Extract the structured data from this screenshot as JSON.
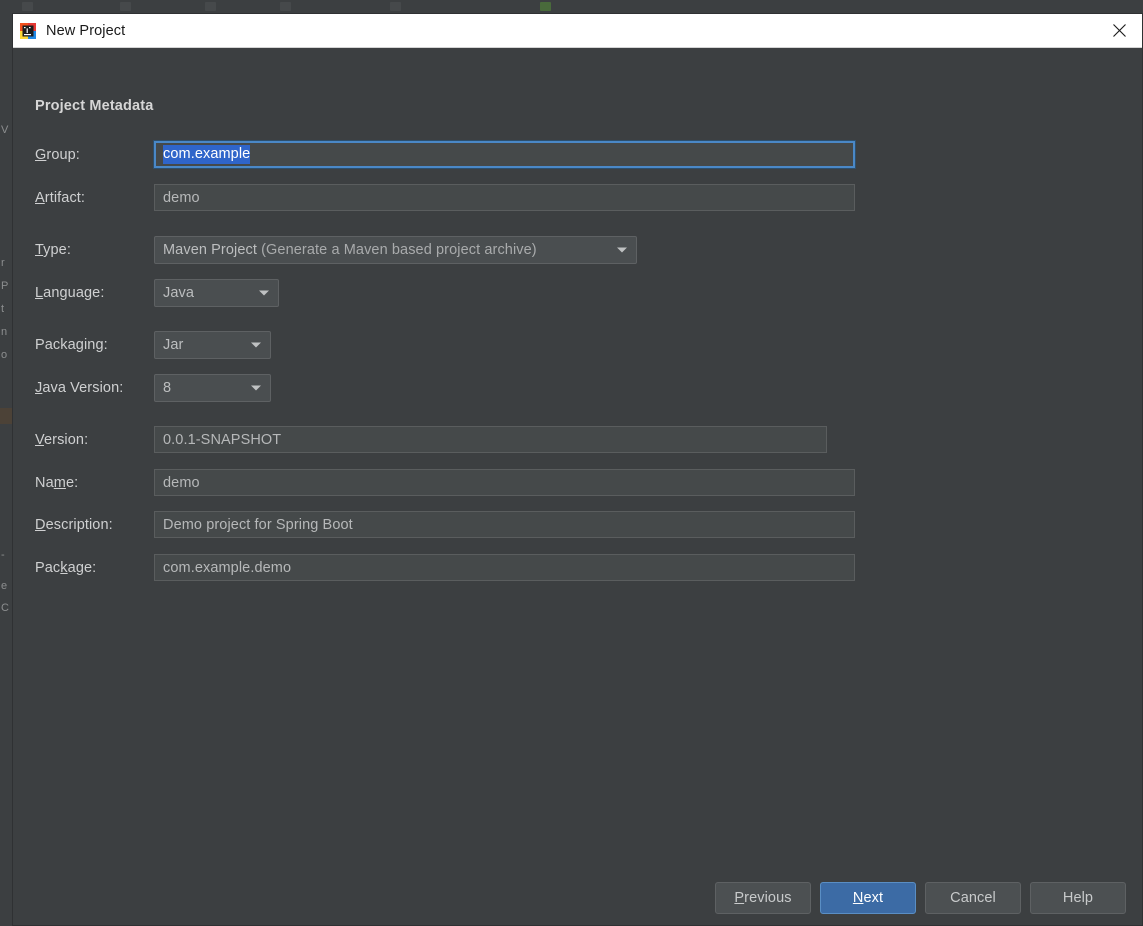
{
  "window": {
    "title": "New Project",
    "app_icon": "intellij-idea-icon",
    "close_icon": "close-icon"
  },
  "dialog": {
    "section_heading": "Project Metadata",
    "fields": [
      {
        "key": "group",
        "label": "Group:",
        "mnemonic": "G",
        "control": "text",
        "value": "com.example",
        "selected": true,
        "focused": true
      },
      {
        "key": "artifact",
        "label": "Artifact:",
        "mnemonic": "A",
        "control": "text",
        "value": "demo",
        "selected": false,
        "focused": false
      },
      {
        "key": "type",
        "label": "Type:",
        "mnemonic": "T",
        "control": "combo",
        "value": "Maven Project",
        "value_detail": "(Generate a Maven based project archive)"
      },
      {
        "key": "language",
        "label": "Language:",
        "mnemonic": "L",
        "control": "combo",
        "value": "Java"
      },
      {
        "key": "packaging",
        "label": "Packaging:",
        "mnemonic": "",
        "control": "combo",
        "value": "Jar"
      },
      {
        "key": "java_version",
        "label": "Java Version:",
        "mnemonic": "J",
        "control": "combo",
        "value": "8"
      },
      {
        "key": "version",
        "label": "Version:",
        "mnemonic": "V",
        "control": "text",
        "value": "0.0.1-SNAPSHOT"
      },
      {
        "key": "name",
        "label": "Name:",
        "mnemonic": "m",
        "control": "text",
        "value": "demo"
      },
      {
        "key": "description",
        "label": "Description:",
        "mnemonic": "D",
        "control": "text",
        "value": "Demo project for Spring Boot"
      },
      {
        "key": "package",
        "label": "Package:",
        "mnemonic": "k",
        "control": "text",
        "value": "com.example.demo"
      }
    ],
    "buttons": [
      {
        "key": "previous",
        "label": "Previous",
        "mnemonic": "P",
        "primary": false
      },
      {
        "key": "next",
        "label": "Next",
        "mnemonic": "N",
        "primary": true
      },
      {
        "key": "cancel",
        "label": "Cancel",
        "mnemonic": "",
        "primary": false
      },
      {
        "key": "help",
        "label": "Help",
        "mnemonic": "",
        "primary": false
      }
    ]
  },
  "background": {
    "left_strip_text": [
      "V",
      "r",
      "P",
      "t",
      "n",
      "o",
      "-",
      "e",
      "C"
    ]
  },
  "colors": {
    "dialog_bg": "#3c3f41",
    "titlebar_bg": "#ffffff",
    "input_bg": "#45494a",
    "combo_bg": "#4a4e50",
    "accent_blue": "#3c6ba5",
    "focus_border": "#4a88c7",
    "selection_blue": "#2f65ca",
    "label_text": "#cfd0d1",
    "value_text": "#b6b8b9"
  }
}
